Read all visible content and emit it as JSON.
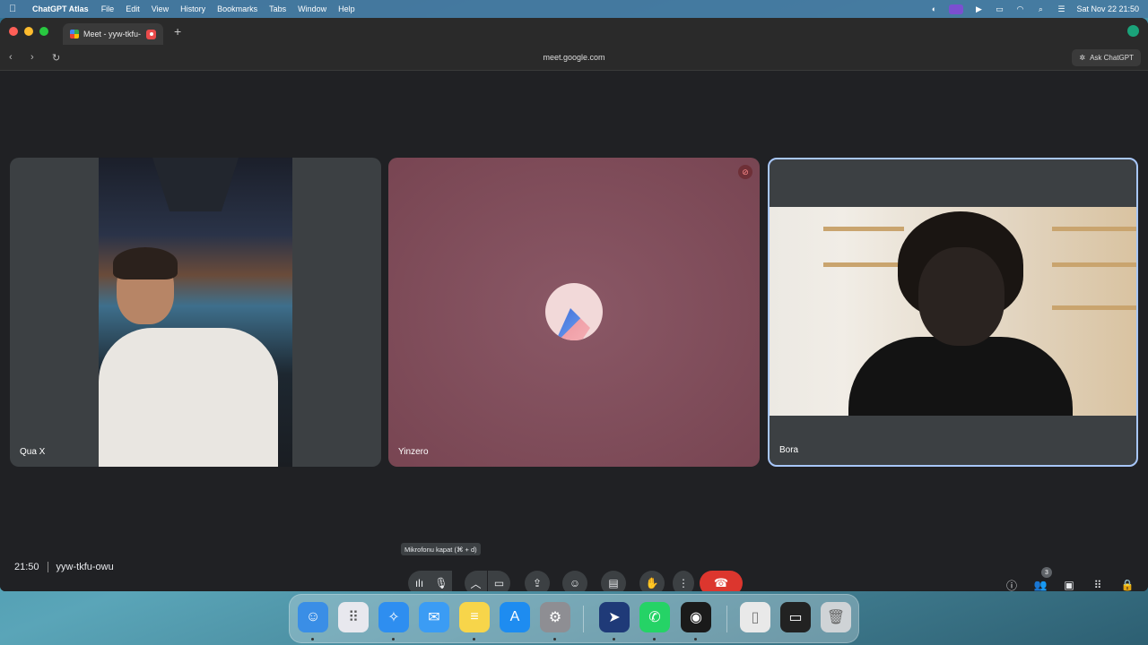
{
  "menubar": {
    "app_name": "ChatGPT Atlas",
    "items": [
      "File",
      "Edit",
      "View",
      "History",
      "Bookmarks",
      "Tabs",
      "Window",
      "Help"
    ],
    "datetime": "Sat Nov 22  21:50"
  },
  "browser": {
    "tab_title": "Meet - yyw-tkfu-",
    "url": "meet.google.com",
    "ask_label": "Ask ChatGPT"
  },
  "participants": [
    {
      "name": "Qua X"
    },
    {
      "name": "Yinzero"
    },
    {
      "name": "Bora"
    }
  ],
  "controls": {
    "time": "21:50",
    "meeting_code": "yyw-tkfu-owu",
    "tooltip": "Mikrofonu kapat (⌘ + d)",
    "people_count": "3"
  },
  "colors": {
    "leave_button": "#dc362e",
    "active_tile_border": "#a8c7fa",
    "meet_background": "#202124"
  }
}
